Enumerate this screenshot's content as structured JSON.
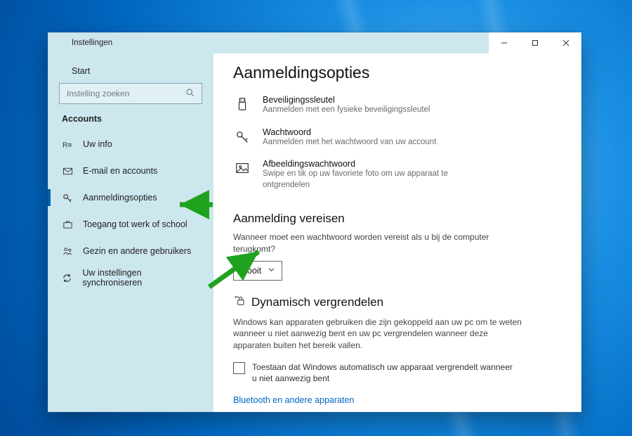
{
  "window": {
    "title": "Instellingen",
    "controls": {
      "min": "—",
      "max": "□",
      "close": "✕"
    }
  },
  "sidebar": {
    "home": "Start",
    "search_placeholder": "Instelling zoeken",
    "group": "Accounts",
    "items": [
      {
        "label": "Uw info"
      },
      {
        "label": "E-mail en accounts"
      },
      {
        "label": "Aanmeldingsopties"
      },
      {
        "label": "Toegang tot werk of school"
      },
      {
        "label": "Gezin en andere gebruikers"
      },
      {
        "label": "Uw instellingen synchroniseren"
      }
    ]
  },
  "page": {
    "title": "Aanmeldingsopties",
    "options": [
      {
        "title": "Beveiligingssleutel",
        "sub": "Aanmelden met een fysieke beveiligingssleutel"
      },
      {
        "title": "Wachtwoord",
        "sub": "Aanmelden met het wachtwoord van uw account"
      },
      {
        "title": "Afbeeldingswachtwoord",
        "sub": "Swipe en tik op uw favoriete foto om uw apparaat te ontgrendelen"
      }
    ],
    "require": {
      "heading": "Aanmelding vereisen",
      "question": "Wanneer moet een wachtwoord worden vereist als u bij de computer terugkomt?",
      "value": "Nooit"
    },
    "dynamic": {
      "heading": "Dynamisch vergrendelen",
      "desc": "Windows kan apparaten gebruiken die zijn gekoppeld aan uw pc om te weten wanneer u niet aanwezig bent en uw pc vergrendelen wanneer deze apparaten buiten het bereik vallen.",
      "checkbox": "Toestaan dat Windows automatisch uw apparaat vergrendelt wanneer u niet aanwezig bent",
      "link": "Bluetooth en andere apparaten"
    }
  }
}
